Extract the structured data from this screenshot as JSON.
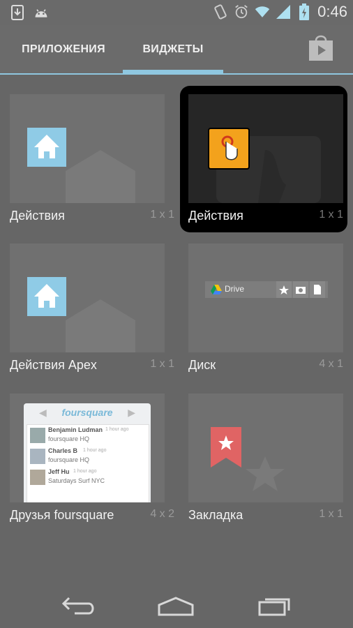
{
  "status_bar": {
    "time": "0:46",
    "icons": [
      "download-icon",
      "android-icon",
      "rotate-icon",
      "alarm-icon",
      "wifi-icon",
      "signal-icon",
      "battery-icon"
    ]
  },
  "tabs": [
    {
      "label": "ПРИЛОЖЕНИЯ",
      "selected": false
    },
    {
      "label": "ВИДЖЕТЫ",
      "selected": true
    }
  ],
  "widgets": [
    {
      "name": "Действия",
      "span": "1 x 1",
      "icon": "home-icon"
    },
    {
      "name": "Действия",
      "span": "1 x 1",
      "icon": "touch-icon",
      "selected": true
    },
    {
      "name": "Действия Apex",
      "span": "1 x 1",
      "icon": "home-icon"
    },
    {
      "name": "Диск",
      "span": "4 x 1",
      "icon": "drive-icon"
    },
    {
      "name": "Друзья foursquare",
      "span": "4 x 2",
      "icon": "foursquare-icon"
    },
    {
      "name": "Закладка",
      "span": "1 x 1",
      "icon": "bookmark-icon"
    }
  ],
  "drive_preview": {
    "label": "Drive"
  },
  "foursquare_preview": {
    "logo": "foursquare",
    "entries": [
      {
        "user": "Benjamin Ludman",
        "time": "1 hour ago",
        "venue": "foursquare HQ"
      },
      {
        "user": "Charles B",
        "time": "1 hour ago",
        "venue": "foursquare HQ"
      },
      {
        "user": "Jeff Hu",
        "time": "1 hour ago",
        "venue": "Saturdays Surf NYC"
      }
    ]
  },
  "colors": {
    "accent": "#8fc7e0",
    "background": "#666666",
    "selected_bg": "#000000"
  },
  "nav": [
    "back-icon",
    "home-icon",
    "recents-icon"
  ]
}
